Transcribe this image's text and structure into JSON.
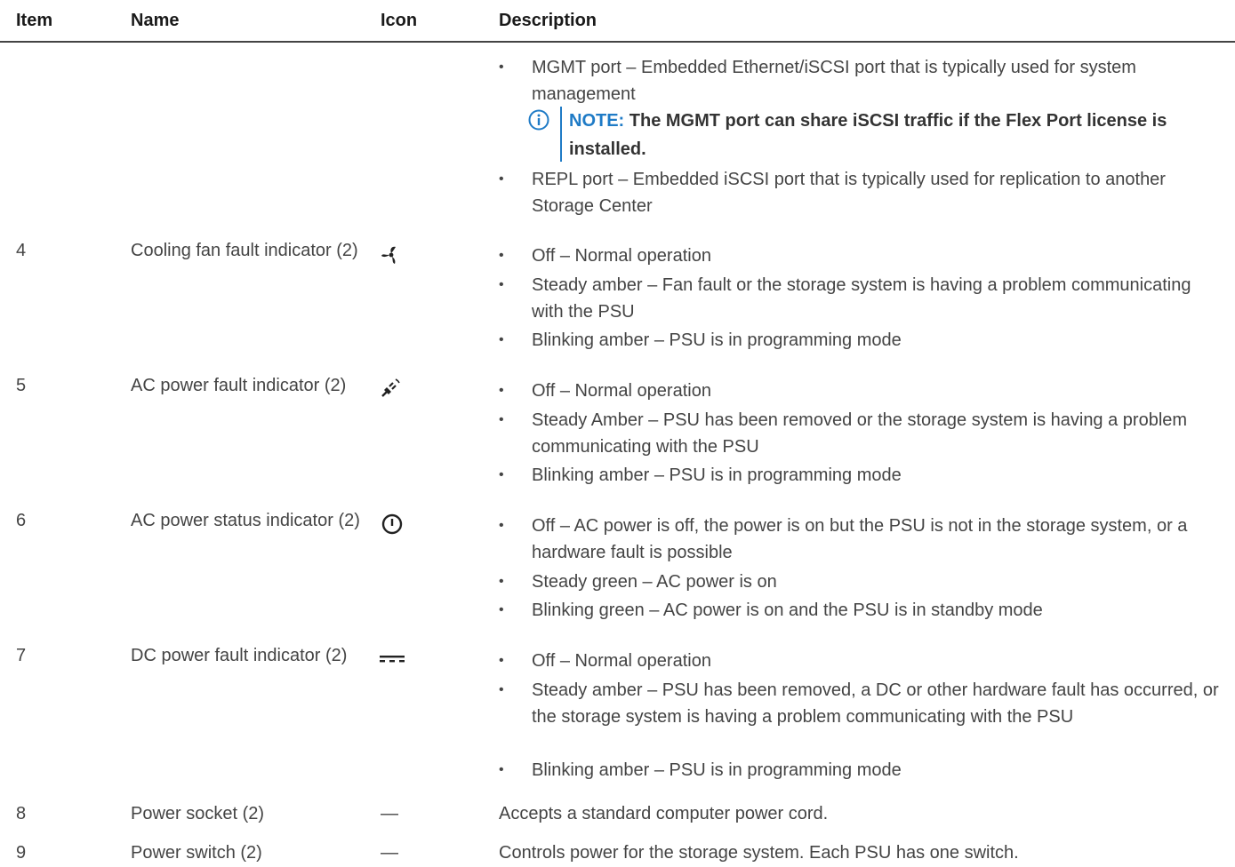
{
  "header": {
    "item": "Item",
    "name": "Name",
    "icon": "Icon",
    "description": "Description"
  },
  "continued": {
    "bullets": [
      "MGMT port – Embedded Ethernet/iSCSI port that is typically used for system management",
      "REPL port – Embedded iSCSI port that is typically used for replication to another Storage Center"
    ],
    "note_label": "NOTE:",
    "note_text": " The MGMT port can share iSCSI traffic if the Flex Port license is installed."
  },
  "rows": [
    {
      "item": "4",
      "name": "Cooling fan fault indicator (2)",
      "icon": "fan-icon",
      "bullets": [
        "Off – Normal operation",
        "Steady amber – Fan fault or the storage system is having a problem communicating with the PSU",
        "Blinking amber – PSU is in programming mode"
      ]
    },
    {
      "item": "5",
      "name": "AC power fault indicator (2)",
      "icon": "ac-plug-icon",
      "bullets": [
        "Off – Normal operation",
        "Steady Amber – PSU has been removed or the storage system is having a problem communicating with the PSU",
        "Blinking amber – PSU is in programming mode"
      ]
    },
    {
      "item": "6",
      "name": "AC power status indicator (2)",
      "icon": "power-icon",
      "bullets": [
        "Off – AC power is off, the power is on but the PSU is not in the storage system, or a hardware fault is possible",
        "Steady green – AC power is on",
        "Blinking green – AC power is on and the PSU is in standby mode"
      ]
    },
    {
      "item": "7",
      "name": "DC power fault indicator (2)",
      "icon": "dc-symbol-icon",
      "bullets": [
        "Off – Normal operation",
        "Steady amber – PSU has been removed, a DC or other hardware fault has occurred, or the storage system is having a problem communicating with the PSU",
        "Blinking amber – PSU is in programming mode"
      ]
    },
    {
      "item": "8",
      "name": "Power socket (2)",
      "icon_text": "—",
      "description": "Accepts a standard computer power cord."
    },
    {
      "item": "9",
      "name": "Power switch (2)",
      "icon_text": "—",
      "description": "Controls power for the storage system. Each PSU has one switch."
    }
  ],
  "colors": {
    "note_accent": "#1f7bc6",
    "text": "#444444",
    "header_rule": "#444444"
  }
}
